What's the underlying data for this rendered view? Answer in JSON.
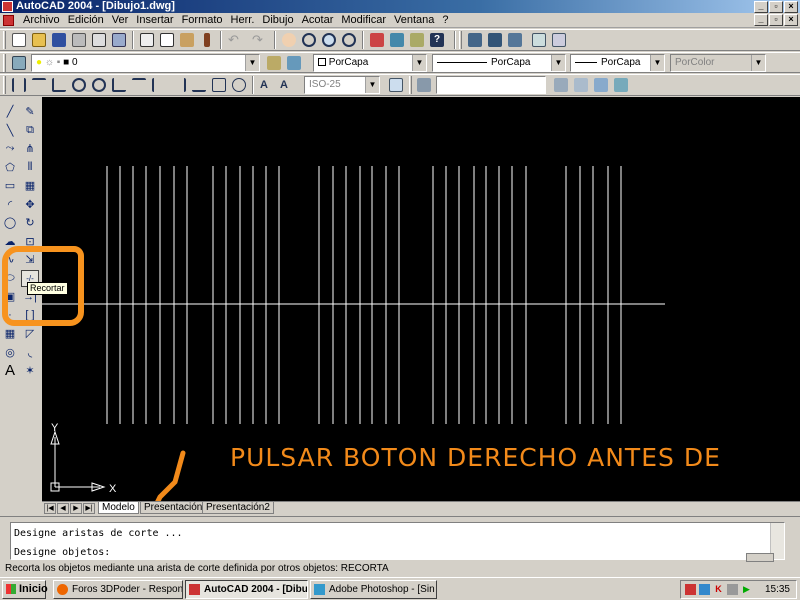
{
  "window": {
    "title": "AutoCAD 2004 - [Dibujo1.dwg]",
    "buttons": [
      "_",
      "▫",
      "×"
    ]
  },
  "menubar": {
    "items": [
      "Archivo",
      "Edición",
      "Ver",
      "Insertar",
      "Formato",
      "Herr.",
      "Dibujo",
      "Acotar",
      "Modificar",
      "Ventana",
      "?"
    ],
    "child_buttons": [
      "_",
      "▫",
      "×"
    ]
  },
  "layers": {
    "current_layer": "0"
  },
  "properties": {
    "color": "PorCapa",
    "linetype": "PorCapa",
    "lineweight": "PorCapa",
    "plotstyle": "PorColor"
  },
  "dimension": {
    "style": "ISO-25"
  },
  "tooltip": {
    "text": "Recortar"
  },
  "annotation": {
    "text": "pulsar boton derecho antes de",
    "color": "#f28a1a"
  },
  "ucs": {
    "x_label": "X",
    "y_label": "Y"
  },
  "layout_tabs": [
    "Modelo",
    "Presentación1",
    "Presentación2"
  ],
  "command_line": {
    "history": "Designe aristas de corte ...",
    "prompt": "Designe objetos:"
  },
  "status_line": "Recorta los objetos mediante una arista de corte definida por otros objetos: RECORTA",
  "taskbar": {
    "start": "Inicio",
    "tasks": [
      "Foros 3DPoder - Respon...",
      "AutoCAD 2004 - [Dibu...",
      "Adobe Photoshop - [Sin t..."
    ],
    "active_task": 1,
    "clock": "15:35"
  },
  "icons": {
    "draw_tools": [
      "line-icon",
      "construction-line-icon",
      "polyline-icon",
      "polygon-icon",
      "rectangle-icon",
      "arc-icon",
      "circle-icon",
      "revision-cloud-icon",
      "spline-icon",
      "ellipse-icon",
      "block-icon",
      "point-icon",
      "hatch-icon",
      "region-icon",
      "text-icon"
    ],
    "modify_tools": [
      "erase-icon",
      "copy-icon",
      "mirror-icon",
      "offset-icon",
      "array-icon",
      "move-icon",
      "rotate-icon",
      "scale-icon",
      "stretch-icon",
      "trim-icon",
      "extend-icon",
      "break-icon",
      "chamfer-icon",
      "fillet-icon",
      "explode-icon"
    ]
  }
}
